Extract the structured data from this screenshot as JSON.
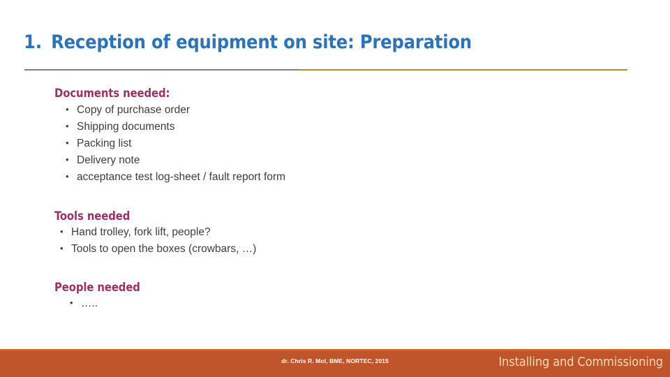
{
  "slide": {
    "title": {
      "number": "1.",
      "text": "Reception of equipment on site: Preparation"
    },
    "sections": [
      {
        "heading": "Documents needed:",
        "items": [
          "Copy of purchase order",
          "Shipping documents",
          "Packing list",
          "Delivery note",
          "acceptance test log-sheet / fault report form"
        ]
      },
      {
        "heading": "Tools needed",
        "items": [
          "Hand trolley, fork lift, people?",
          "Tools to open the boxes (crowbars, …)"
        ]
      },
      {
        "heading": "People needed",
        "items": [
          "….."
        ]
      }
    ],
    "footer": {
      "credit": "dr. Chris R. Mol, BME, NORTEC, 2015",
      "section_label": "Installing and Commissioning"
    },
    "colors": {
      "title": "#2E74B5",
      "heading": "#993366",
      "body": "#3D3D3D",
      "rule_left": "#808080",
      "rule_right": "#C0892A",
      "footer_bar": "#C0542A",
      "footer_text": "#F2D9B8"
    }
  }
}
